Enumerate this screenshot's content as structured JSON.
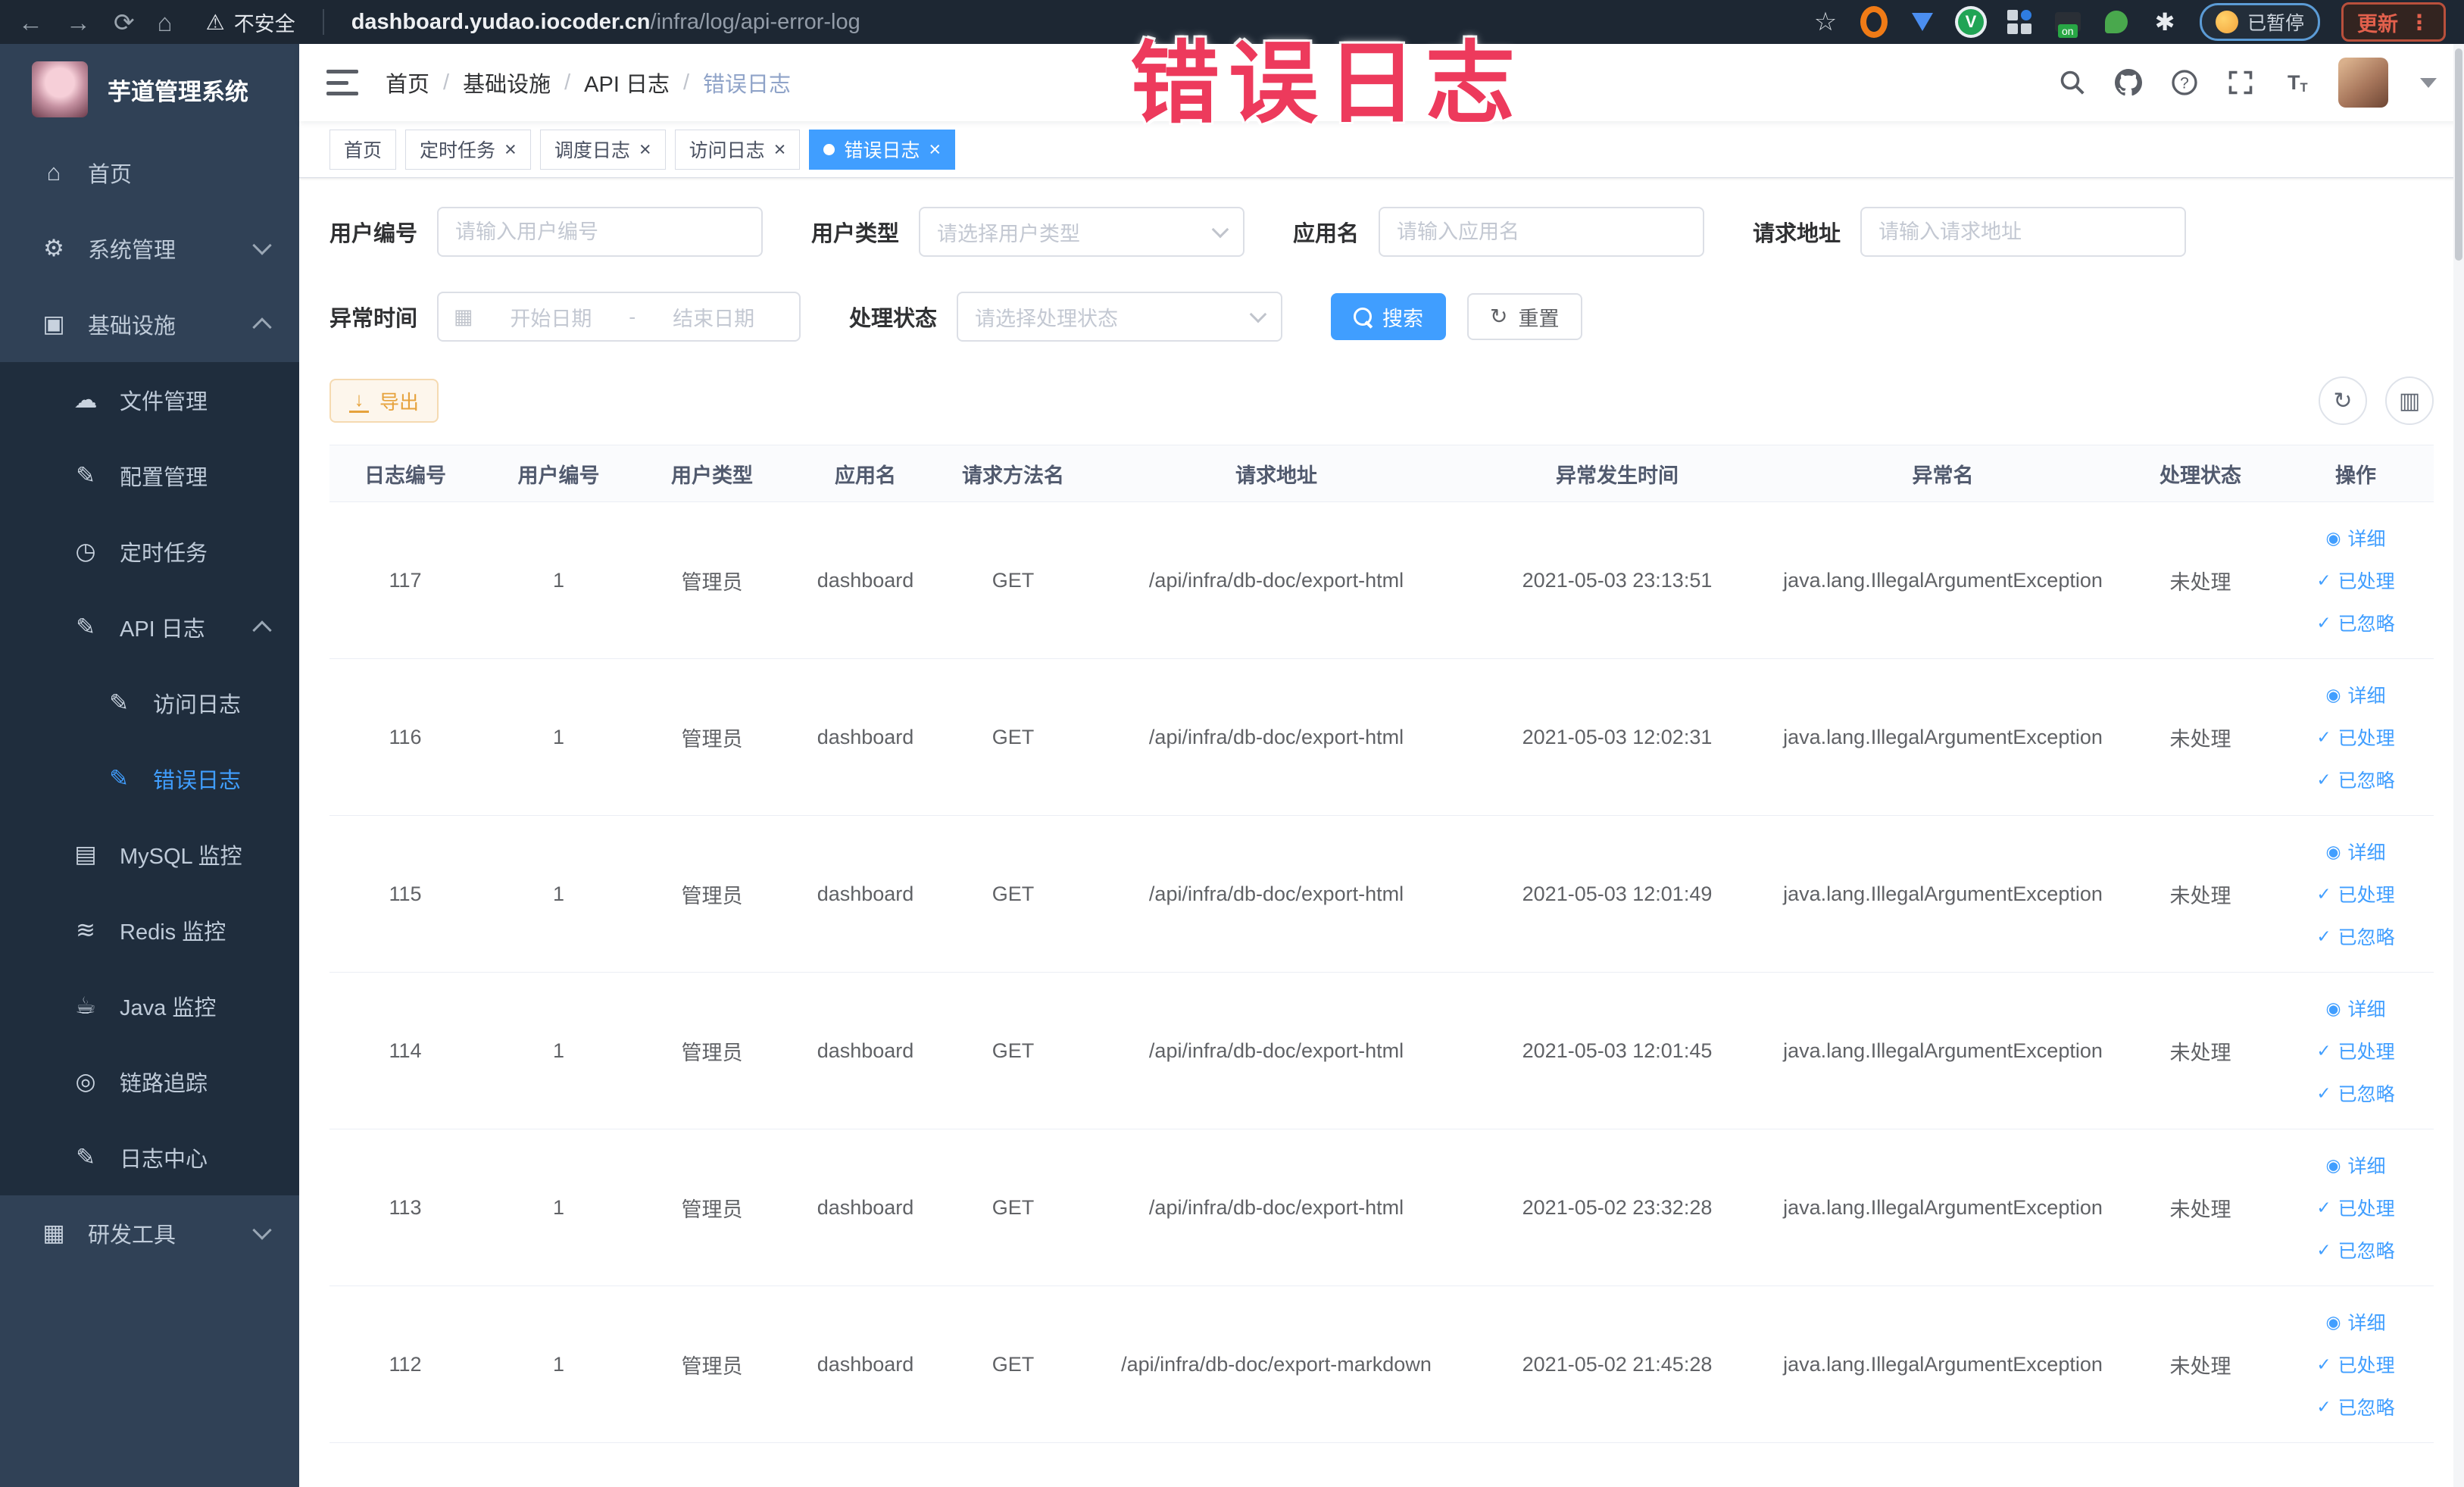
{
  "browser": {
    "security_label": "不安全",
    "url_host": "dashboard.yudao.iocoder.cn",
    "url_path": "/infra/log/api-error-log",
    "paused_label": "已暂停",
    "update_label": "更新"
  },
  "watermark": "错误日志",
  "sidebar": {
    "logo_title": "芋道管理系统",
    "items": [
      {
        "label": "首页",
        "level": 1,
        "icon": "home-icon"
      },
      {
        "label": "系统管理",
        "level": 1,
        "icon": "gear-icon",
        "chevron": "down"
      },
      {
        "label": "基础设施",
        "level": 1,
        "icon": "monitor-icon",
        "chevron": "up"
      },
      {
        "label": "文件管理",
        "level": 2,
        "icon": "cloud-upload-icon"
      },
      {
        "label": "配置管理",
        "level": 2,
        "icon": "edit-icon"
      },
      {
        "label": "定时任务",
        "level": 2,
        "icon": "clock-icon"
      },
      {
        "label": "API 日志",
        "level": 2,
        "icon": "edit-icon",
        "chevron": "up"
      },
      {
        "label": "访问日志",
        "level": 3,
        "icon": "edit-icon"
      },
      {
        "label": "错误日志",
        "level": 3,
        "icon": "edit-icon",
        "active": true
      },
      {
        "label": "MySQL 监控",
        "level": 2,
        "icon": "chart-icon"
      },
      {
        "label": "Redis 监控",
        "level": 2,
        "icon": "database-icon"
      },
      {
        "label": "Java 监控",
        "level": 2,
        "icon": "java-icon"
      },
      {
        "label": "链路追踪",
        "level": 2,
        "icon": "eye-icon"
      },
      {
        "label": "日志中心",
        "level": 2,
        "icon": "edit-icon"
      },
      {
        "label": "研发工具",
        "level": 1,
        "icon": "toolbox-icon",
        "chevron": "down"
      }
    ],
    "icon_glyphs": {
      "home-icon": "⌂",
      "gear-icon": "⚙",
      "monitor-icon": "▣",
      "cloud-upload-icon": "☁",
      "edit-icon": "✎",
      "clock-icon": "◷",
      "chart-icon": "▤",
      "database-icon": "≋",
      "java-icon": "☕",
      "eye-icon": "◎",
      "toolbox-icon": "▦"
    }
  },
  "header": {
    "breadcrumb": [
      "首页",
      "基础设施",
      "API 日志",
      "错误日志"
    ]
  },
  "tabs": [
    {
      "label": "首页",
      "closable": false,
      "active": false
    },
    {
      "label": "定时任务",
      "closable": true,
      "active": false
    },
    {
      "label": "调度日志",
      "closable": true,
      "active": false
    },
    {
      "label": "访问日志",
      "closable": true,
      "active": false
    },
    {
      "label": "错误日志",
      "closable": true,
      "active": true
    }
  ],
  "filters": {
    "user_id": {
      "label": "用户编号",
      "placeholder": "请输入用户编号"
    },
    "user_type": {
      "label": "用户类型",
      "placeholder": "请选择用户类型"
    },
    "app_name": {
      "label": "应用名",
      "placeholder": "请输入应用名"
    },
    "request_url": {
      "label": "请求地址",
      "placeholder": "请输入请求地址"
    },
    "exception_time": {
      "label": "异常时间",
      "start_placeholder": "开始日期",
      "separator": "-",
      "end_placeholder": "结束日期"
    },
    "process_status": {
      "label": "处理状态",
      "placeholder": "请选择处理状态"
    },
    "search_label": "搜索",
    "reset_label": "重置"
  },
  "toolbar": {
    "export_label": "导出"
  },
  "table": {
    "headers": [
      "日志编号",
      "用户编号",
      "用户类型",
      "应用名",
      "请求方法名",
      "请求地址",
      "异常发生时间",
      "异常名",
      "处理状态",
      "操作"
    ],
    "action_links": [
      {
        "icon": "eye-icon",
        "glyph": "◉",
        "label": "详细"
      },
      {
        "icon": "check-icon",
        "glyph": "✓",
        "label": "已处理"
      },
      {
        "icon": "check-icon",
        "glyph": "✓",
        "label": "已忽略"
      }
    ],
    "rows": [
      {
        "log_id": "117",
        "user_id": "1",
        "user_type": "管理员",
        "app_name": "dashboard",
        "method": "GET",
        "url": "/api/infra/db-doc/export-html",
        "time": "2021-05-03 23:13:51",
        "exception": "java.lang.IllegalArgumentException",
        "status": "未处理"
      },
      {
        "log_id": "116",
        "user_id": "1",
        "user_type": "管理员",
        "app_name": "dashboard",
        "method": "GET",
        "url": "/api/infra/db-doc/export-html",
        "time": "2021-05-03 12:02:31",
        "exception": "java.lang.IllegalArgumentException",
        "status": "未处理"
      },
      {
        "log_id": "115",
        "user_id": "1",
        "user_type": "管理员",
        "app_name": "dashboard",
        "method": "GET",
        "url": "/api/infra/db-doc/export-html",
        "time": "2021-05-03 12:01:49",
        "exception": "java.lang.IllegalArgumentException",
        "status": "未处理"
      },
      {
        "log_id": "114",
        "user_id": "1",
        "user_type": "管理员",
        "app_name": "dashboard",
        "method": "GET",
        "url": "/api/infra/db-doc/export-html",
        "time": "2021-05-03 12:01:45",
        "exception": "java.lang.IllegalArgumentException",
        "status": "未处理"
      },
      {
        "log_id": "113",
        "user_id": "1",
        "user_type": "管理员",
        "app_name": "dashboard",
        "method": "GET",
        "url": "/api/infra/db-doc/export-html",
        "time": "2021-05-02 23:32:28",
        "exception": "java.lang.IllegalArgumentException",
        "status": "未处理"
      },
      {
        "log_id": "112",
        "user_id": "1",
        "user_type": "管理员",
        "app_name": "dashboard",
        "method": "GET",
        "url": "/api/infra/db-doc/export-markdown",
        "time": "2021-05-02 21:45:28",
        "exception": "java.lang.IllegalArgumentException",
        "status": "未处理"
      }
    ]
  },
  "colors": {
    "primary": "#409EFF",
    "sidebar_bg": "#304156",
    "submenu_bg": "#1f2d3d",
    "watermark": "#ed3a5c",
    "export_warning": "#e6a23c",
    "browser_bar_bg": "#1d2733"
  }
}
